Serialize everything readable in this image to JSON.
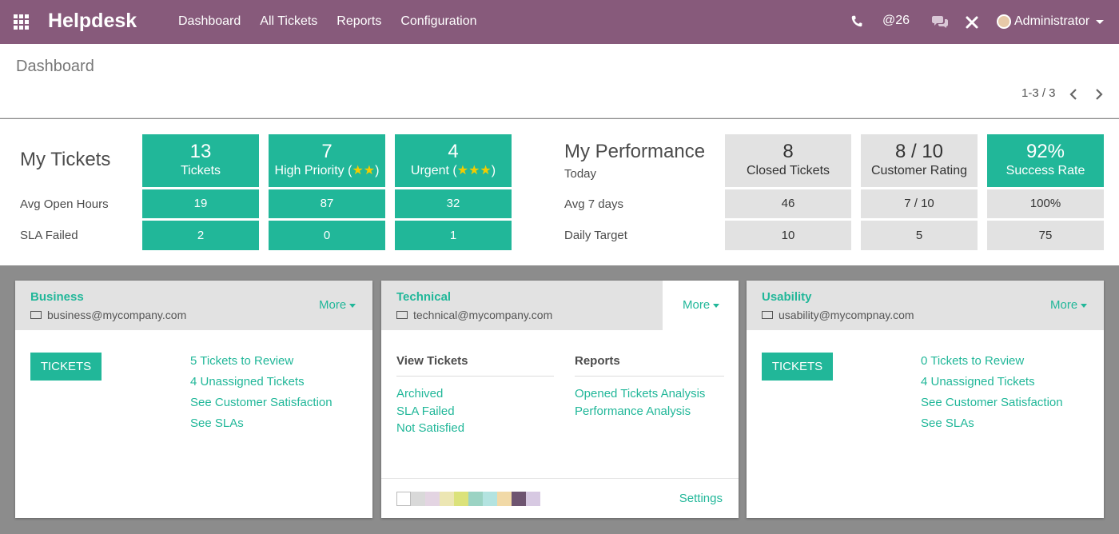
{
  "navbar": {
    "brand": "Helpdesk",
    "menu": [
      "Dashboard",
      "All Tickets",
      "Reports",
      "Configuration"
    ],
    "mention_count": "@26",
    "user": "Administrator"
  },
  "control_panel": {
    "title": "Dashboard",
    "pager": "1-3 / 3"
  },
  "my_tickets": {
    "heading": "My Tickets",
    "row_labels": [
      "Avg Open Hours",
      "SLA Failed"
    ],
    "tiles": [
      {
        "value": "13",
        "label": "Tickets",
        "stars": "",
        "avg_open_hours": "19",
        "sla_failed": "2"
      },
      {
        "value": "7",
        "label": "High Priority (",
        "stars": "★★",
        "avg_open_hours": "87",
        "sla_failed": "0"
      },
      {
        "value": "4",
        "label": "Urgent (",
        "stars": "★★★",
        "avg_open_hours": "32",
        "sla_failed": "1"
      }
    ]
  },
  "my_performance": {
    "heading": "My Performance",
    "today_label": "Today",
    "row_labels": [
      "Avg 7 days",
      "Daily Target"
    ],
    "tiles": [
      {
        "value": "8",
        "label": "Closed Tickets",
        "avg_7_days": "46",
        "daily_target": "10"
      },
      {
        "value": "8 / 10",
        "label": "Customer Rating",
        "avg_7_days": "7 / 10",
        "daily_target": "5"
      },
      {
        "value": "92%",
        "label": "Success Rate",
        "avg_7_days": "100%",
        "daily_target": "75"
      }
    ]
  },
  "teams": [
    {
      "name": "Business",
      "email": "business@mycompany.com",
      "more": "More",
      "button": "TICKETS",
      "links": [
        "5 Tickets to Review",
        "4 Unassigned Tickets",
        "See Customer Satisfaction",
        "See SLAs"
      ]
    },
    {
      "name": "Technical",
      "email": "technical@mycompany.com",
      "more": "More",
      "view_title": "View Tickets",
      "view_links": [
        "Archived",
        "SLA Failed",
        "Not Satisfied"
      ],
      "reports_title": "Reports",
      "reports_links": [
        "Opened Tickets Analysis",
        "Performance Analysis"
      ],
      "settings": "Settings",
      "swatch_colors": [
        "#ffffff",
        "#d9d9d9",
        "#e3d4e2",
        "#ece6b3",
        "#dbe27a",
        "#9bd3c3",
        "#b3e3e0",
        "#f1d9a7",
        "#6e5470",
        "#d7c9e2"
      ]
    },
    {
      "name": "Usability",
      "email": "usability@mycompnay.com",
      "more": "More",
      "button": "TICKETS",
      "links": [
        "0 Tickets to Review",
        "4 Unassigned Tickets",
        "See Customer Satisfaction",
        "See SLAs"
      ]
    }
  ],
  "colors": {
    "navbar": "#875a7b",
    "accent": "#21b799",
    "tile_grey": "#e2e2e2",
    "star": "#f3cc00"
  }
}
